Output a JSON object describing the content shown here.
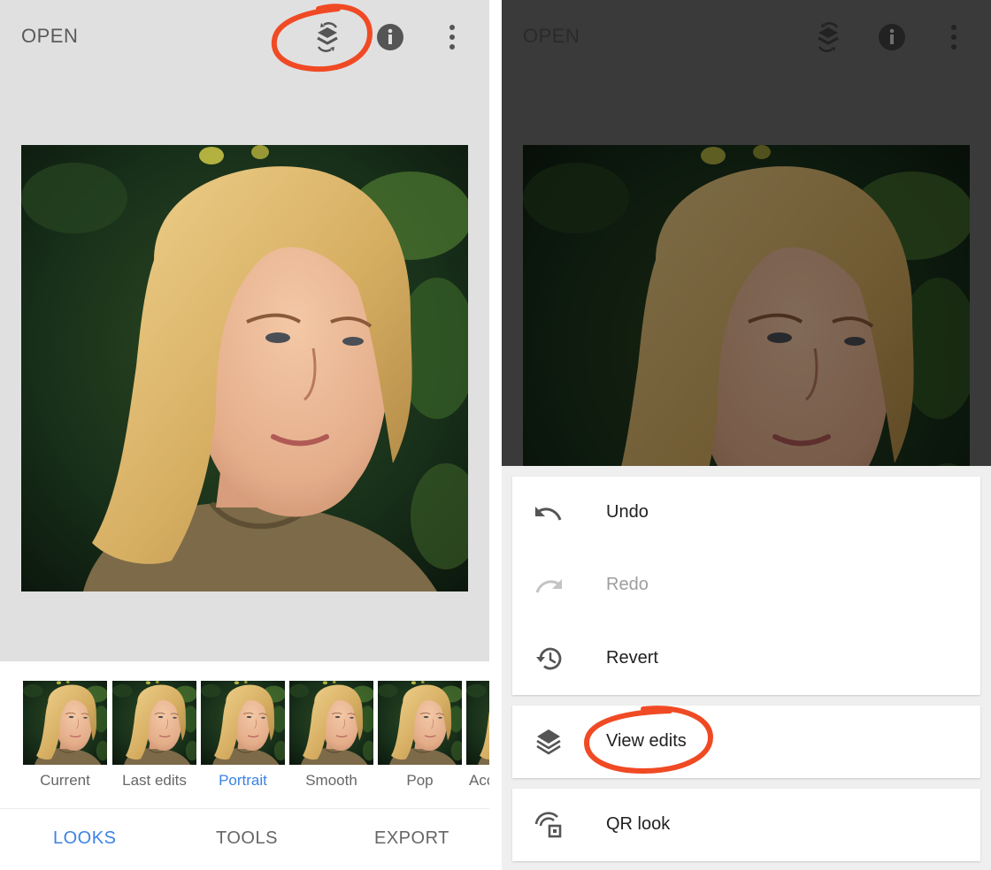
{
  "left_screen": {
    "topbar": {
      "open_label": "OPEN",
      "icons": [
        "undo-stack-icon",
        "info-icon",
        "more-vert-icon"
      ]
    },
    "looks": [
      {
        "label": "Current",
        "active": false
      },
      {
        "label": "Last edits",
        "active": false
      },
      {
        "label": "Portrait",
        "active": true
      },
      {
        "label": "Smooth",
        "active": false
      },
      {
        "label": "Pop",
        "active": false
      },
      {
        "label": "Acc",
        "active": false
      }
    ],
    "tabs": [
      {
        "label": "LOOKS",
        "active": true
      },
      {
        "label": "TOOLS",
        "active": false
      },
      {
        "label": "EXPORT",
        "active": false
      }
    ]
  },
  "right_screen": {
    "topbar": {
      "open_label": "OPEN"
    },
    "menu": [
      {
        "label": "Undo",
        "icon": "undo-icon",
        "enabled": true
      },
      {
        "label": "Redo",
        "icon": "redo-icon",
        "enabled": false
      },
      {
        "label": "Revert",
        "icon": "history-icon",
        "enabled": true
      }
    ],
    "view_edits": {
      "label": "View edits",
      "icon": "layers-icon"
    },
    "qr_look": {
      "label": "QR look",
      "icon": "qr-look-icon"
    }
  },
  "colors": {
    "accent": "#3b82e6",
    "annotation": "#f04a24",
    "photo_background": "#1e3a1a",
    "hair": "#d8b46a",
    "skin": "#e9b595"
  }
}
